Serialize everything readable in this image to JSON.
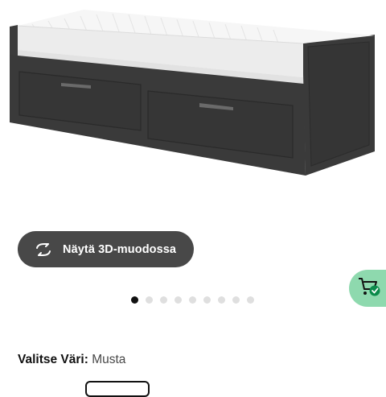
{
  "product": {
    "image_alt": "Daybed with drawers in black-brown",
    "view_3d_label": "Näytä 3D-muodossa",
    "view_3d_icon": "rotate-3d-icon"
  },
  "cart": {
    "icon": "add-to-cart-icon",
    "accent": "#8ed9ae"
  },
  "carousel": {
    "total": 9,
    "active_index": 0
  },
  "color_selector": {
    "label": "Valitse Väri:",
    "selected_value": "Musta"
  },
  "colors": {
    "button_bg": "#484848",
    "dot_active": "#111111",
    "dot_inactive": "#dfdfdf"
  }
}
